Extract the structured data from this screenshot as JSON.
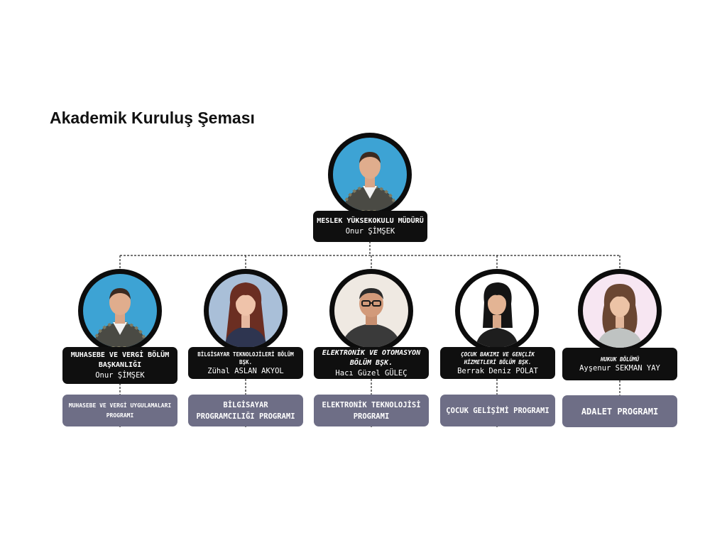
{
  "title": "Akademik Kuruluş Şeması",
  "colors": {
    "card": "#0f0f0f",
    "program": "#6e6e86",
    "photo_bg_blue": "#3da3d4",
    "photo_bg_grey": "#a9bfd8",
    "photo_bg_light": "#efe9e2",
    "photo_bg_pink": "#f7e6f2"
  },
  "director": {
    "role": "MESLEK YÜKSEKOKULU MÜDÜRÜ",
    "name": "Onur ŞİMŞEK",
    "photo": "portrait-male-striped-sweater"
  },
  "departments": [
    {
      "role": "MUHASEBE VE VERGİ BÖLÜM BAŞKANLIĞI",
      "name": "Onur ŞİMŞEK",
      "program": "MUHASEBE VE VERGİ UYGULAMALARI PROGRAMI",
      "photo": "portrait-male-striped-sweater"
    },
    {
      "role": "BİLGİSAYAR TEKNOLOJİLERİ BÖLÜM BŞK.",
      "name": "Zühal ASLAN AKYOL",
      "program": "BİLGİSAYAR PROGRAMCILIĞI PROGRAMI",
      "photo": "portrait-female-long-hair"
    },
    {
      "role": "ELEKTRONİK VE OTOMASYON BÖLÜM BŞK.",
      "name": "Hacı Güzel GÜLEÇ",
      "program": "ELEKTRONİK TEKNOLOJİSİ PROGRAMI",
      "photo": "portrait-male-glasses"
    },
    {
      "role": "ÇOCUK BAKIMI VE GENÇLİK HİZMETLERİ BÖLÜM BŞK.",
      "name": "Berrak Deniz POLAT",
      "program": "ÇOCUK GELİŞİMİ PROGRAMI",
      "photo": "portrait-female-dark-hair"
    },
    {
      "role": "HUKUK BÖLÜMÜ",
      "name": "Ayşenur SEKMAN YAY",
      "program": "ADALET PROGRAMI",
      "photo": "portrait-female-wavy-hair"
    }
  ]
}
